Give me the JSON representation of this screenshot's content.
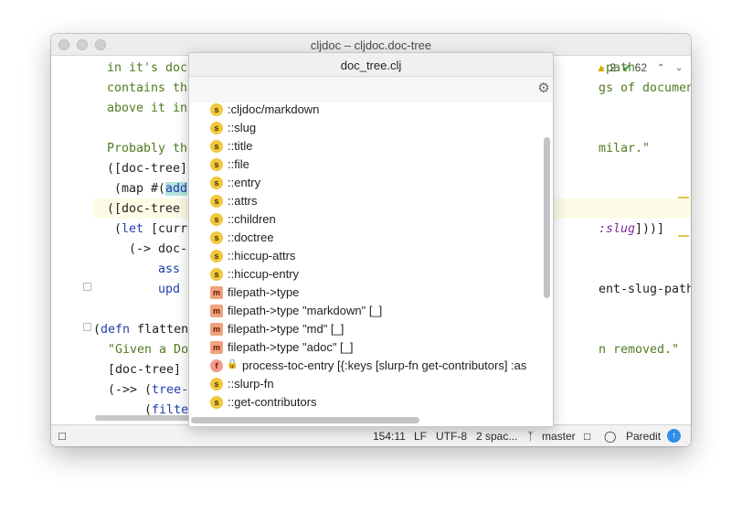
{
  "window": {
    "title": "cljdoc – cljdoc.doc-tree"
  },
  "inspections": {
    "warnings": "2",
    "ok": "62"
  },
  "code": {
    "l1a": "in it's doc",
    "l1b": "-path",
    "l2a": "contains th",
    "l2b": "gs of documents",
    "l3a": "above it in",
    "l5a": "Probably th",
    "l5b": "milar.\"",
    "l6a": "([doc-tree]",
    "l7a": " (map #(",
    "l7b": "add",
    "l8a": "([doc-tree",
    "l9a": " (",
    "l9b": "let",
    "l9c": " [curr",
    "l9d": ":slug",
    "l9e": "]))]",
    "l10a": "   (-> doc-",
    "l11a": "       ",
    "l11b": "ass",
    "l12a": "       ",
    "l12b": "upd",
    "l12c": "ent-slug-path) xs)",
    "l14a": "(",
    "l14b": "defn",
    "l14c": " flatten",
    "l15a": "  \"Given a Do",
    "l15b": "n removed.\"",
    "l16a": "  [doc-tree]",
    "l17a": "  (->> (",
    "l17b": "tree-",
    "l18a": "       (",
    "l18b": "filte"
  },
  "popup": {
    "title": "doc_tree.clj",
    "items": [
      {
        "icon": "s",
        "label": ":cljdoc/markdown"
      },
      {
        "icon": "s",
        "label": "::slug"
      },
      {
        "icon": "s",
        "label": "::title"
      },
      {
        "icon": "s",
        "label": "::file"
      },
      {
        "icon": "s",
        "label": "::entry"
      },
      {
        "icon": "s",
        "label": "::attrs"
      },
      {
        "icon": "s",
        "label": "::children"
      },
      {
        "icon": "s",
        "label": "::doctree"
      },
      {
        "icon": "s",
        "label": "::hiccup-attrs"
      },
      {
        "icon": "s",
        "label": "::hiccup-entry"
      },
      {
        "icon": "m",
        "label": "filepath->type"
      },
      {
        "icon": "m",
        "label": "filepath->type \"markdown\" [_]"
      },
      {
        "icon": "m",
        "label": "filepath->type \"md\" [_]"
      },
      {
        "icon": "m",
        "label": "filepath->type \"adoc\" [_]"
      },
      {
        "icon": "f",
        "label": "process-toc-entry [{:keys [slurp-fn get-contributors] :as"
      },
      {
        "icon": "s",
        "label": "::slurp-fn"
      },
      {
        "icon": "s",
        "label": "::get-contributors"
      }
    ]
  },
  "status": {
    "position": "154:11",
    "line_sep": "LF",
    "encoding": "UTF-8",
    "indent": "2 spac...",
    "branch": "master",
    "mode": "Paredit"
  },
  "colors": {
    "accent": "#2f8fe8",
    "string": "#507b21",
    "keyword": "#1f3fae"
  }
}
